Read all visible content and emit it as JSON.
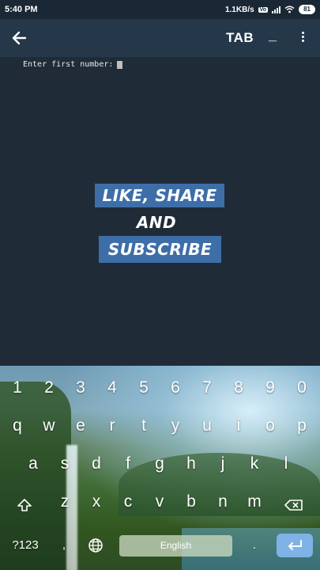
{
  "status_bar": {
    "time": "5:40 PM",
    "network_speed": "1.1KB/s",
    "volte": "Vo",
    "battery": "81"
  },
  "action_bar": {
    "back_icon": "arrow-left-icon",
    "tab_label": "TAB",
    "minimize_label": "_",
    "menu_icon": "more-vert-icon"
  },
  "terminal": {
    "prompt": "Enter first number:"
  },
  "overlay": {
    "line1": "LIKE, SHARE",
    "line2": "AND",
    "line3": "SUBSCRIBE"
  },
  "keyboard": {
    "number_row": [
      "1",
      "2",
      "3",
      "4",
      "5",
      "6",
      "7",
      "8",
      "9",
      "0"
    ],
    "row1": [
      "q",
      "w",
      "e",
      "r",
      "t",
      "y",
      "u",
      "i",
      "o",
      "p"
    ],
    "row2": [
      "a",
      "s",
      "d",
      "f",
      "g",
      "h",
      "j",
      "k",
      "l"
    ],
    "row3": [
      "z",
      "x",
      "c",
      "v",
      "b",
      "n",
      "m"
    ],
    "symbols_label": "?123",
    "comma": ",",
    "space_label": "English",
    "period": ".",
    "shift_icon": "shift-icon",
    "backspace_icon": "backspace-icon",
    "globe_icon": "globe-icon",
    "enter_icon": "enter-icon"
  },
  "colors": {
    "terminal_bg": "#1f2c38",
    "action_bar_bg": "#25384a",
    "overlay_bg": "#3d6ea8",
    "enter_key": "#7fb2e6"
  }
}
